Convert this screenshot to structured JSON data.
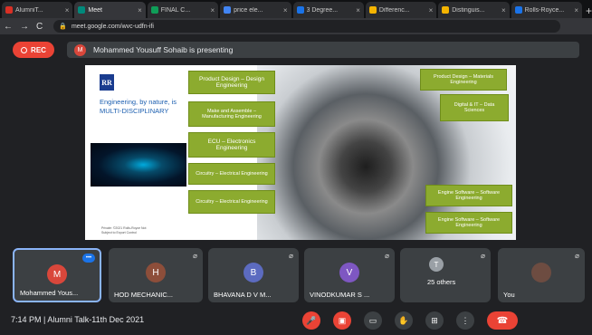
{
  "tabs": [
    {
      "title": "AlumniT...",
      "color": "#d93025",
      "active": false
    },
    {
      "title": "Meet",
      "color": "#00897b",
      "active": true
    },
    {
      "title": "FINAL C...",
      "color": "#0f9d58",
      "active": false
    },
    {
      "title": "price ele...",
      "color": "#4285f4",
      "active": false
    },
    {
      "title": "3 Degree...",
      "color": "#1a73e8",
      "active": false
    },
    {
      "title": "Differenc...",
      "color": "#f4b400",
      "active": false
    },
    {
      "title": "Distinguis...",
      "color": "#f4b400",
      "active": false
    },
    {
      "title": "Rolls-Royce...",
      "color": "#1a73e8",
      "active": false
    }
  ],
  "address": {
    "url": "meet.google.com/wvc-udfn-ifi"
  },
  "rec": {
    "label": "REC"
  },
  "presenter": {
    "avatar": "M",
    "text": "Mohammed Yousuff Sohaib is presenting"
  },
  "slide": {
    "logo": "RR",
    "tagline": "Engineering, by nature, is MULTI-DISCIPLINARY",
    "footer": "Private: ©2021 Rolls-Royce Not Subject to Export Control",
    "left_boxes": [
      "Product Design – Design Engineering",
      "Make and Assemble – Manufacturing Engineering",
      "ECU – Electronics Engineering",
      "Circuitry – Electrical Engineering",
      "Circuitry – Electrical Engineering"
    ],
    "right_boxes": [
      "Product Design – Materials Engineering",
      "Digital & IT – Data Sciences",
      "Engine Software – Software Engineering",
      "Engine Software – Software Engineering"
    ]
  },
  "participants": [
    {
      "initial": "M",
      "name": "Mohammed Yous...",
      "color": "#d9473b",
      "speaking": true
    },
    {
      "initial": "H",
      "name": "HOD MECHANIC...",
      "color": "#8d4e3a",
      "speaking": false
    },
    {
      "initial": "B",
      "name": "BHAVANA D V M...",
      "color": "#5c6bc0",
      "speaking": false
    },
    {
      "initial": "V",
      "name": "VINODKUMAR S ...",
      "color": "#7e57c2",
      "speaking": false
    },
    {
      "initial": "T",
      "name": "25 others",
      "color": "#9aa0a6",
      "speaking": false
    },
    {
      "initial": "",
      "name": "You",
      "color": "#6d4c41",
      "speaking": false
    }
  ],
  "meeting": {
    "time": "7:14 PM",
    "separator": "|",
    "title": "Alumni Talk-11th Dec 2021"
  }
}
